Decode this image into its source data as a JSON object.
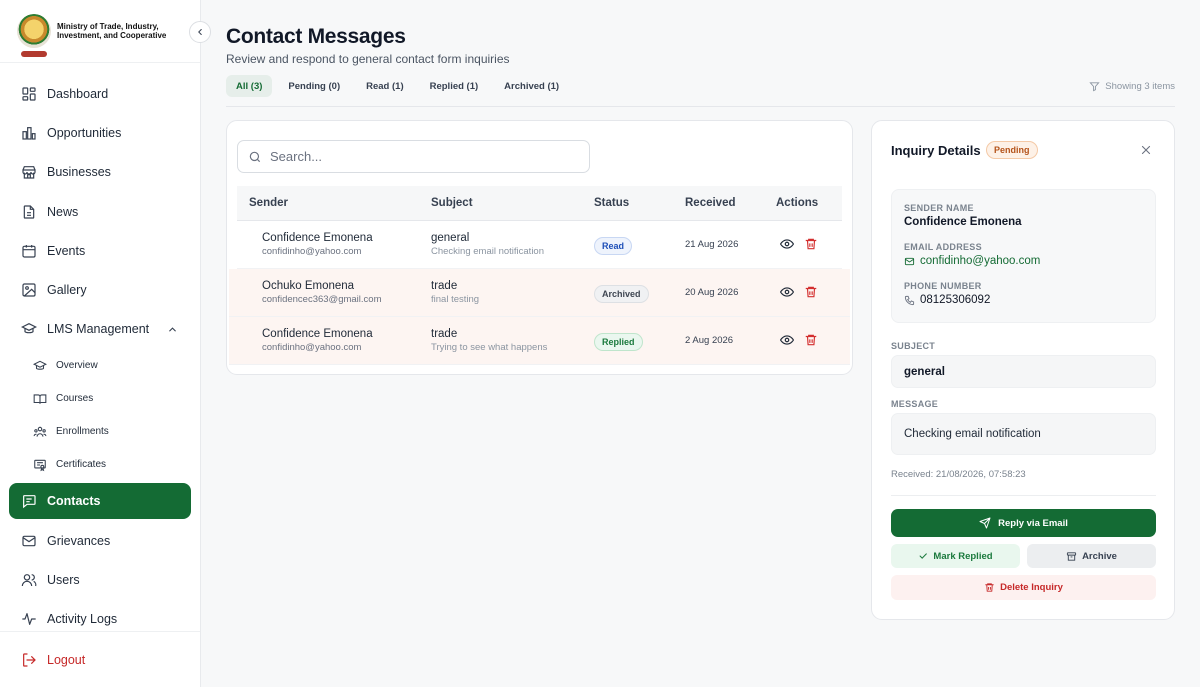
{
  "brand": {
    "name": "Ministry of Trade, Industry, Investment, and Cooperative"
  },
  "sidebar": {
    "items": [
      {
        "label": "Dashboard",
        "icon": "dashboard-icon"
      },
      {
        "label": "Opportunities",
        "icon": "bar-chart-icon"
      },
      {
        "label": "Businesses",
        "icon": "store-icon"
      },
      {
        "label": "News",
        "icon": "document-icon"
      },
      {
        "label": "Events",
        "icon": "calendar-icon"
      },
      {
        "label": "Gallery",
        "icon": "image-icon"
      },
      {
        "label": "LMS Management",
        "icon": "graduation-cap-icon"
      }
    ],
    "lms_sub": [
      {
        "label": "Overview",
        "icon": "graduation-cap-icon"
      },
      {
        "label": "Courses",
        "icon": "book-icon"
      },
      {
        "label": "Enrollments",
        "icon": "users-icon"
      },
      {
        "label": "Certificates",
        "icon": "certificate-icon"
      }
    ],
    "bottom_items": [
      {
        "label": "Contacts",
        "icon": "message-icon",
        "active": true
      },
      {
        "label": "Grievances",
        "icon": "mail-icon"
      },
      {
        "label": "Users",
        "icon": "users-icon"
      },
      {
        "label": "Activity Logs",
        "icon": "activity-icon"
      }
    ],
    "logout": "Logout",
    "accent": "#146b34"
  },
  "page": {
    "title": "Contact Messages",
    "subtitle": "Review and respond to general contact form inquiries",
    "tabs": [
      "All (3)",
      "Pending (0)",
      "Read (1)",
      "Replied (1)",
      "Archived (1)"
    ],
    "active_tab": "All (3)",
    "showing": "Showing 3 items"
  },
  "search": {
    "placeholder": "Search..."
  },
  "table": {
    "headers": {
      "sender": "Sender",
      "subject": "Subject",
      "status": "Status",
      "received": "Received",
      "actions": "Actions"
    },
    "rows": [
      {
        "name": "Confidence Emonena",
        "email": "confidinho@yahoo.com",
        "subject": "general",
        "message": "Checking email notification",
        "status": "Read",
        "received": "21 Aug 2026"
      },
      {
        "name": "Ochuko Emonena",
        "email": "confidencec363@gmail.com",
        "subject": "trade",
        "message": "final testing",
        "status": "Archived",
        "received": "20 Aug 2026"
      },
      {
        "name": "Confidence Emonena",
        "email": "confidinho@yahoo.com",
        "subject": "trade",
        "message": "Trying to see what happens",
        "status": "Replied",
        "received": "2 Aug 2026"
      }
    ]
  },
  "detail": {
    "title": "Inquiry Details",
    "status": "Pending",
    "sender_label": "SENDER NAME",
    "sender": "Confidence Emonena",
    "email_label": "EMAIL ADDRESS",
    "email": "confidinho@yahoo.com",
    "phone_label": "PHONE NUMBER",
    "phone": "08125306092",
    "subject_label": "SUBJECT",
    "subject": "general",
    "message_label": "MESSAGE",
    "message": "Checking email notification",
    "received": "Received: 21/08/2026, 07:58:23",
    "reply_button": "Reply via Email",
    "mark_button": "Mark Replied",
    "archive_button": "Archive",
    "delete_button": "Delete Inquiry"
  }
}
